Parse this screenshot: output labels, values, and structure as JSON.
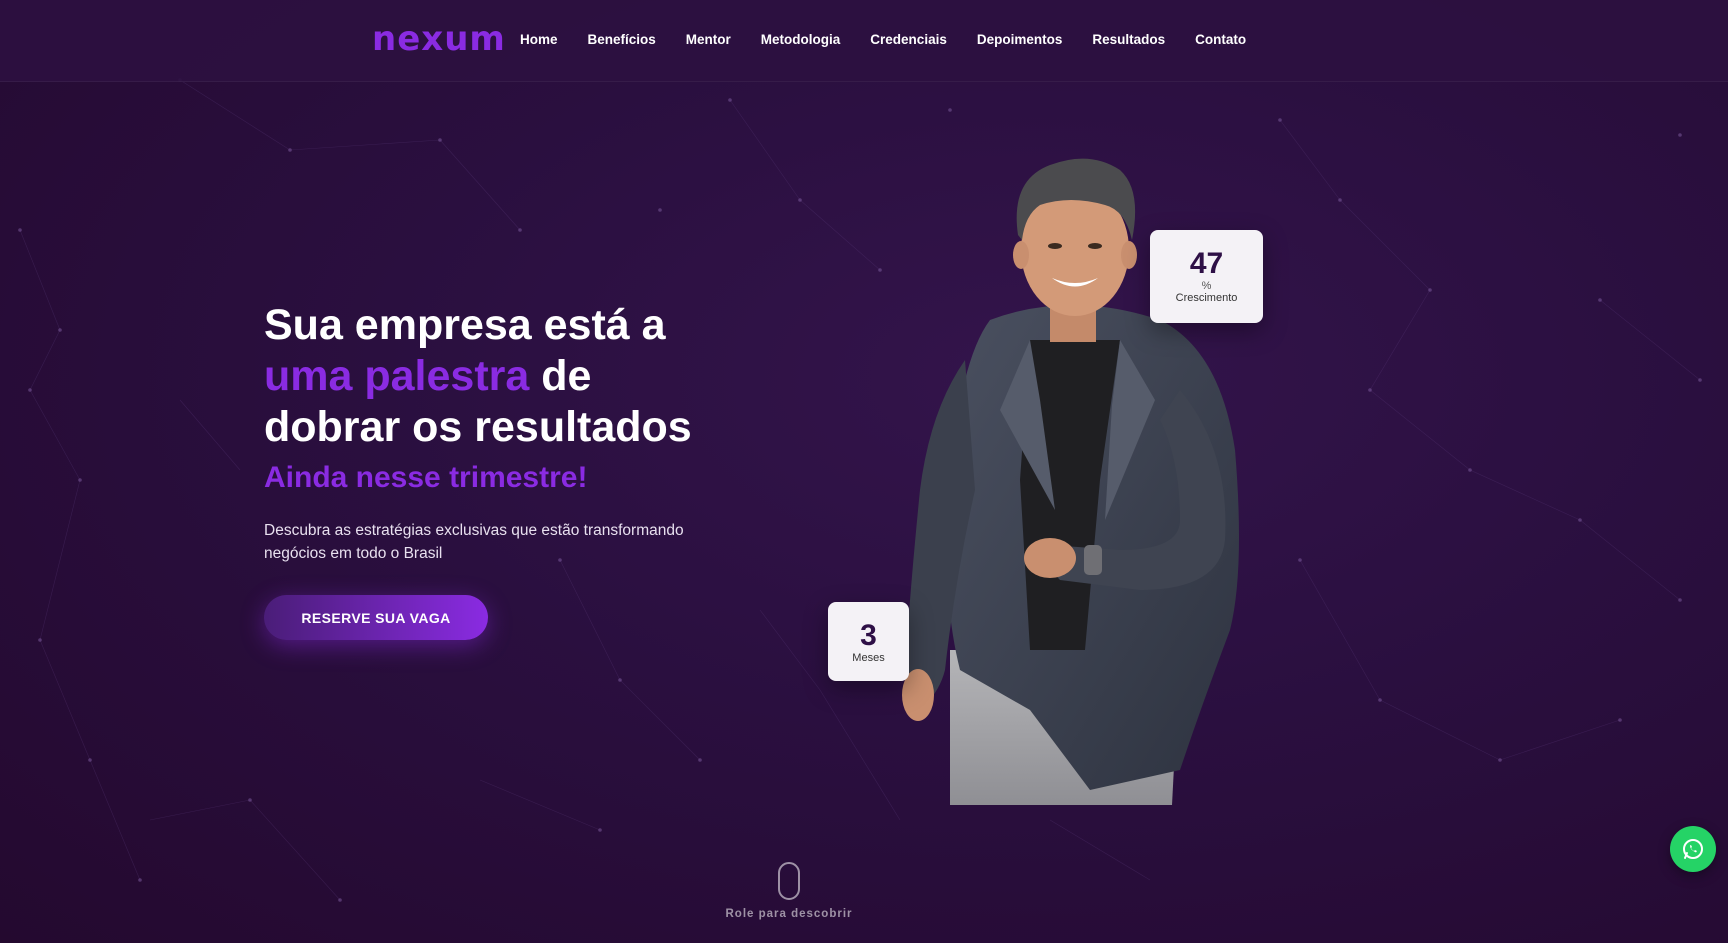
{
  "brand": {
    "logo_text": "nexum",
    "accent_color": "#8a2be2"
  },
  "nav": {
    "items": [
      {
        "label": "Home"
      },
      {
        "label": "Benefícios"
      },
      {
        "label": "Mentor"
      },
      {
        "label": "Metodologia"
      },
      {
        "label": "Credenciais"
      },
      {
        "label": "Depoimentos"
      },
      {
        "label": "Resultados"
      },
      {
        "label": "Contato"
      }
    ]
  },
  "hero": {
    "title_line1": "Sua empresa está a",
    "title_accent": "uma palestra",
    "title_after_accent": " de",
    "title_line3": "dobrar os resultados",
    "subtitle": "Ainda nesse trimestre!",
    "description": "Descubra as estratégias exclusivas que estão transformando negócios em todo o Brasil",
    "cta_label": "RESERVE SUA VAGA"
  },
  "stats": {
    "growth": {
      "value": "47",
      "unit": "%",
      "label": "Crescimento"
    },
    "months": {
      "value": "3",
      "label": "Meses"
    }
  },
  "scroll_hint": {
    "label": "Role para descobrir"
  },
  "icons": {
    "whatsapp": "whatsapp-icon"
  }
}
